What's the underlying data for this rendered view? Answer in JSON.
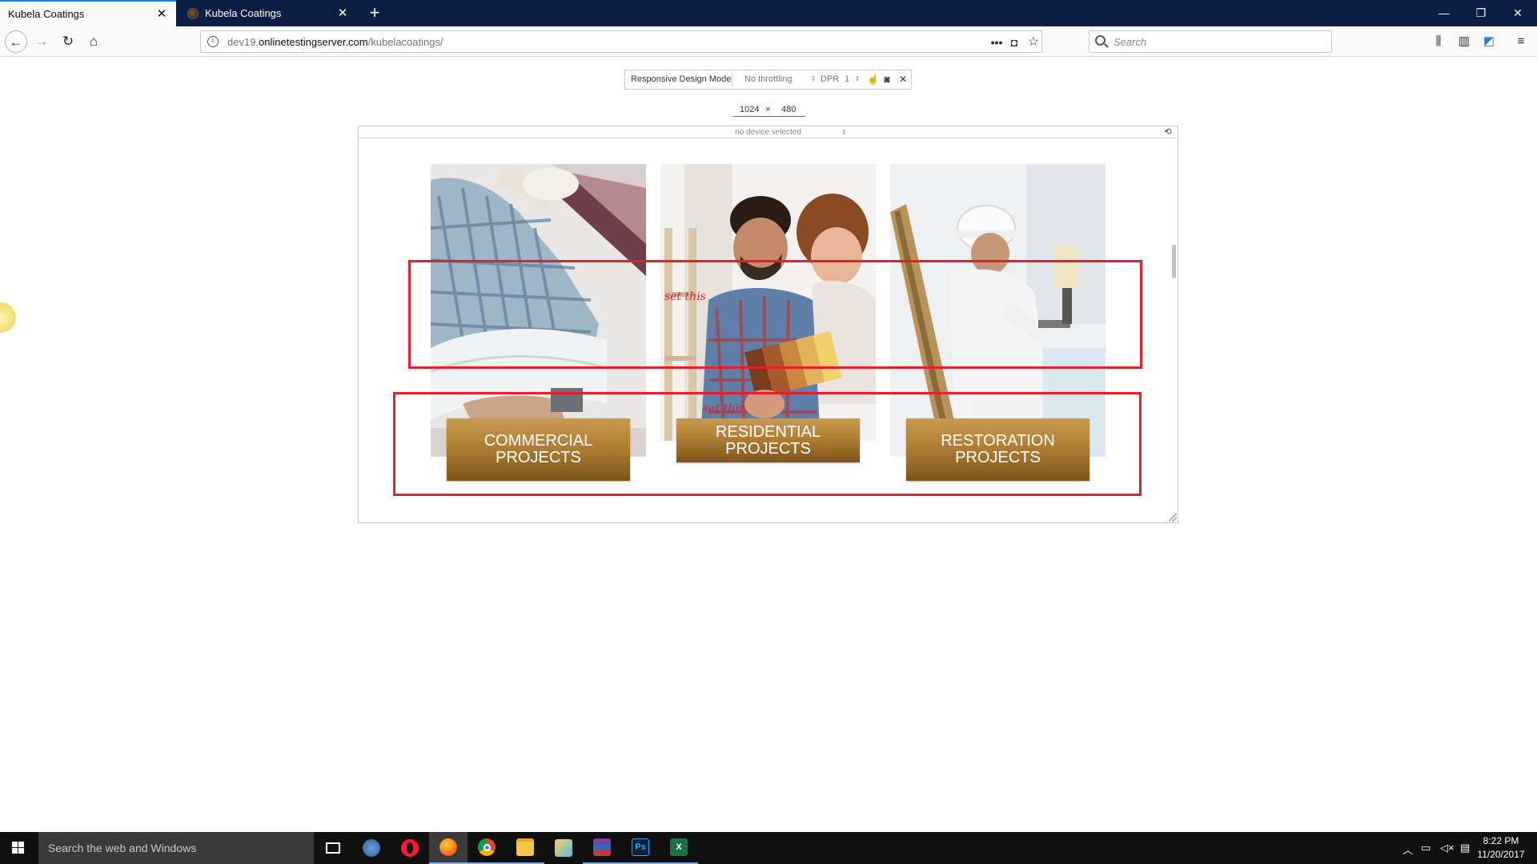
{
  "browser": {
    "tabs": [
      {
        "title": "Kubela Coatings",
        "active": true
      },
      {
        "title": "Kubela Coatings",
        "active": false
      }
    ],
    "new_tab": "+",
    "url_prefix": "dev19.",
    "url_host": "onlinetestingserver.com",
    "url_path": "/kubelacoatings/",
    "search_placeholder": "Search"
  },
  "rdm": {
    "label": "Responsive Design Mode",
    "throttling": "No throttling",
    "dpr_label": "DPR",
    "dpr_value": "1",
    "width": "1024",
    "height": "480",
    "times": "×",
    "device": "no device selected"
  },
  "page": {
    "projects": [
      {
        "label": "COMMERCIAL\nPROJECTS",
        "photo": "worker-with-blueprints-photo"
      },
      {
        "label": "RESIDENTIAL PROJECTS",
        "photo": "couple-with-color-swatches-photo"
      },
      {
        "label": "RESTORATION\nPROJECTS",
        "photo": "painter-with-roller-photo"
      }
    ]
  },
  "annotations": {
    "note_top": "set this",
    "note_bottom": "set this",
    "color": "#e5202a"
  },
  "taskbar": {
    "search_placeholder": "Search the web and Windows",
    "apps": [
      "task-view",
      "browser-globe",
      "opera",
      "firefox",
      "chrome",
      "file-explorer",
      "folder",
      "winrar",
      "photoshop",
      "excel"
    ],
    "ps_label": "Ps",
    "excel_label": "X",
    "time": "8:22 PM",
    "date": "11/20/2017"
  }
}
